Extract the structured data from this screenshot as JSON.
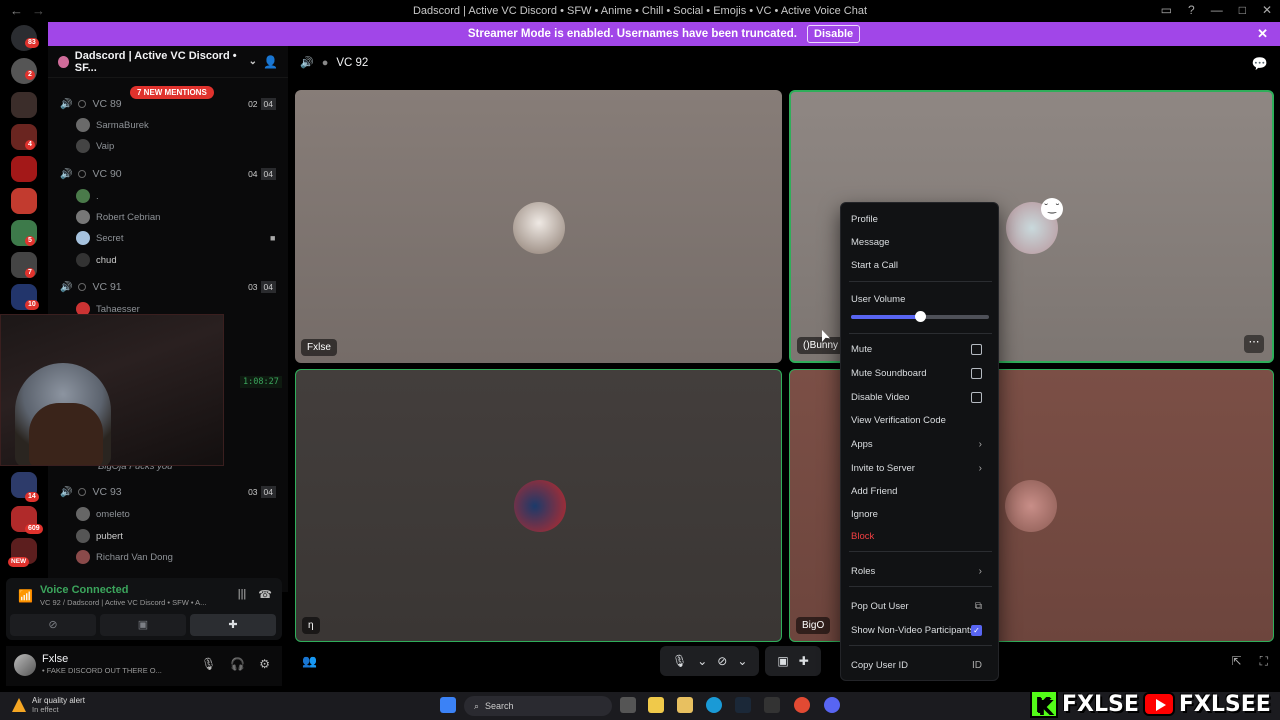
{
  "window": {
    "title": "Dadscord | Active VC Discord • SFW • Anime • Chill • Social • Emojis • VC • Active Voice Chat"
  },
  "banner": {
    "text": "Streamer Mode is enabled. Usernames have been truncated.",
    "button": "Disable"
  },
  "rail": {
    "badges": [
      "83",
      "2",
      "4",
      "5",
      "7",
      "10",
      "14",
      "609",
      "NEW"
    ]
  },
  "sidebar": {
    "server_name": "Dadscord | Active VC Discord • SF...",
    "mentions_pill": "7 NEW MENTIONS",
    "channels": [
      {
        "name": "VC 89",
        "a": "02",
        "b": "04",
        "members": [
          "SarmaBurek",
          "Vaip"
        ]
      },
      {
        "name": "VC 90",
        "a": "04",
        "b": "04",
        "members": [
          ".",
          "Robert Cebrian",
          "Secret",
          "chud"
        ]
      },
      {
        "name": "VC 91",
        "a": "03",
        "b": "04",
        "members": [
          "Tahaesser"
        ]
      },
      {
        "name": "VC 93",
        "a": "03",
        "b": "04",
        "members": [
          "omeleto",
          "pubert",
          "Richard Van Dong"
        ]
      }
    ],
    "hidden_member": "BigOja Fucks you",
    "timer": "1:08:27"
  },
  "voice_panel": {
    "status": "Voice Connected",
    "subtitle": "VC 92 / Dadscord | Active VC Discord • SFW • A..."
  },
  "user_panel": {
    "name": "Fxlse",
    "status": "• FAKE DISCORD OUT THERE O..."
  },
  "main": {
    "channel": "VC 92",
    "tiles": [
      {
        "name": "Fxlse"
      },
      {
        "name": "()Bunny"
      },
      {
        "name": "ƞ"
      },
      {
        "name": "BigO"
      }
    ]
  },
  "context_menu": {
    "items": {
      "profile": "Profile",
      "message": "Message",
      "call": "Start a Call",
      "volume_label": "User Volume",
      "mute": "Mute",
      "mute_soundboard": "Mute Soundboard",
      "disable_video": "Disable Video",
      "verification": "View Verification Code",
      "apps": "Apps",
      "invite": "Invite to Server",
      "add_friend": "Add Friend",
      "ignore": "Ignore",
      "block": "Block",
      "roles": "Roles",
      "pop_out": "Pop Out User",
      "show_nonvideo": "Show Non-Video Participants",
      "copy_id": "Copy User ID"
    },
    "user_volume": 0.5,
    "show_nonvideo_checked": true
  },
  "taskbar": {
    "weather_title": "Air quality alert",
    "weather_sub": "In effect",
    "search": "Search"
  },
  "overlay": {
    "handle1": "FXLSE",
    "handle2": "FXLSEE"
  },
  "colors": {
    "accent": "#a146e8",
    "speaking": "#2fae5a",
    "danger": "#f23f42",
    "blurple": "#5865f2"
  }
}
